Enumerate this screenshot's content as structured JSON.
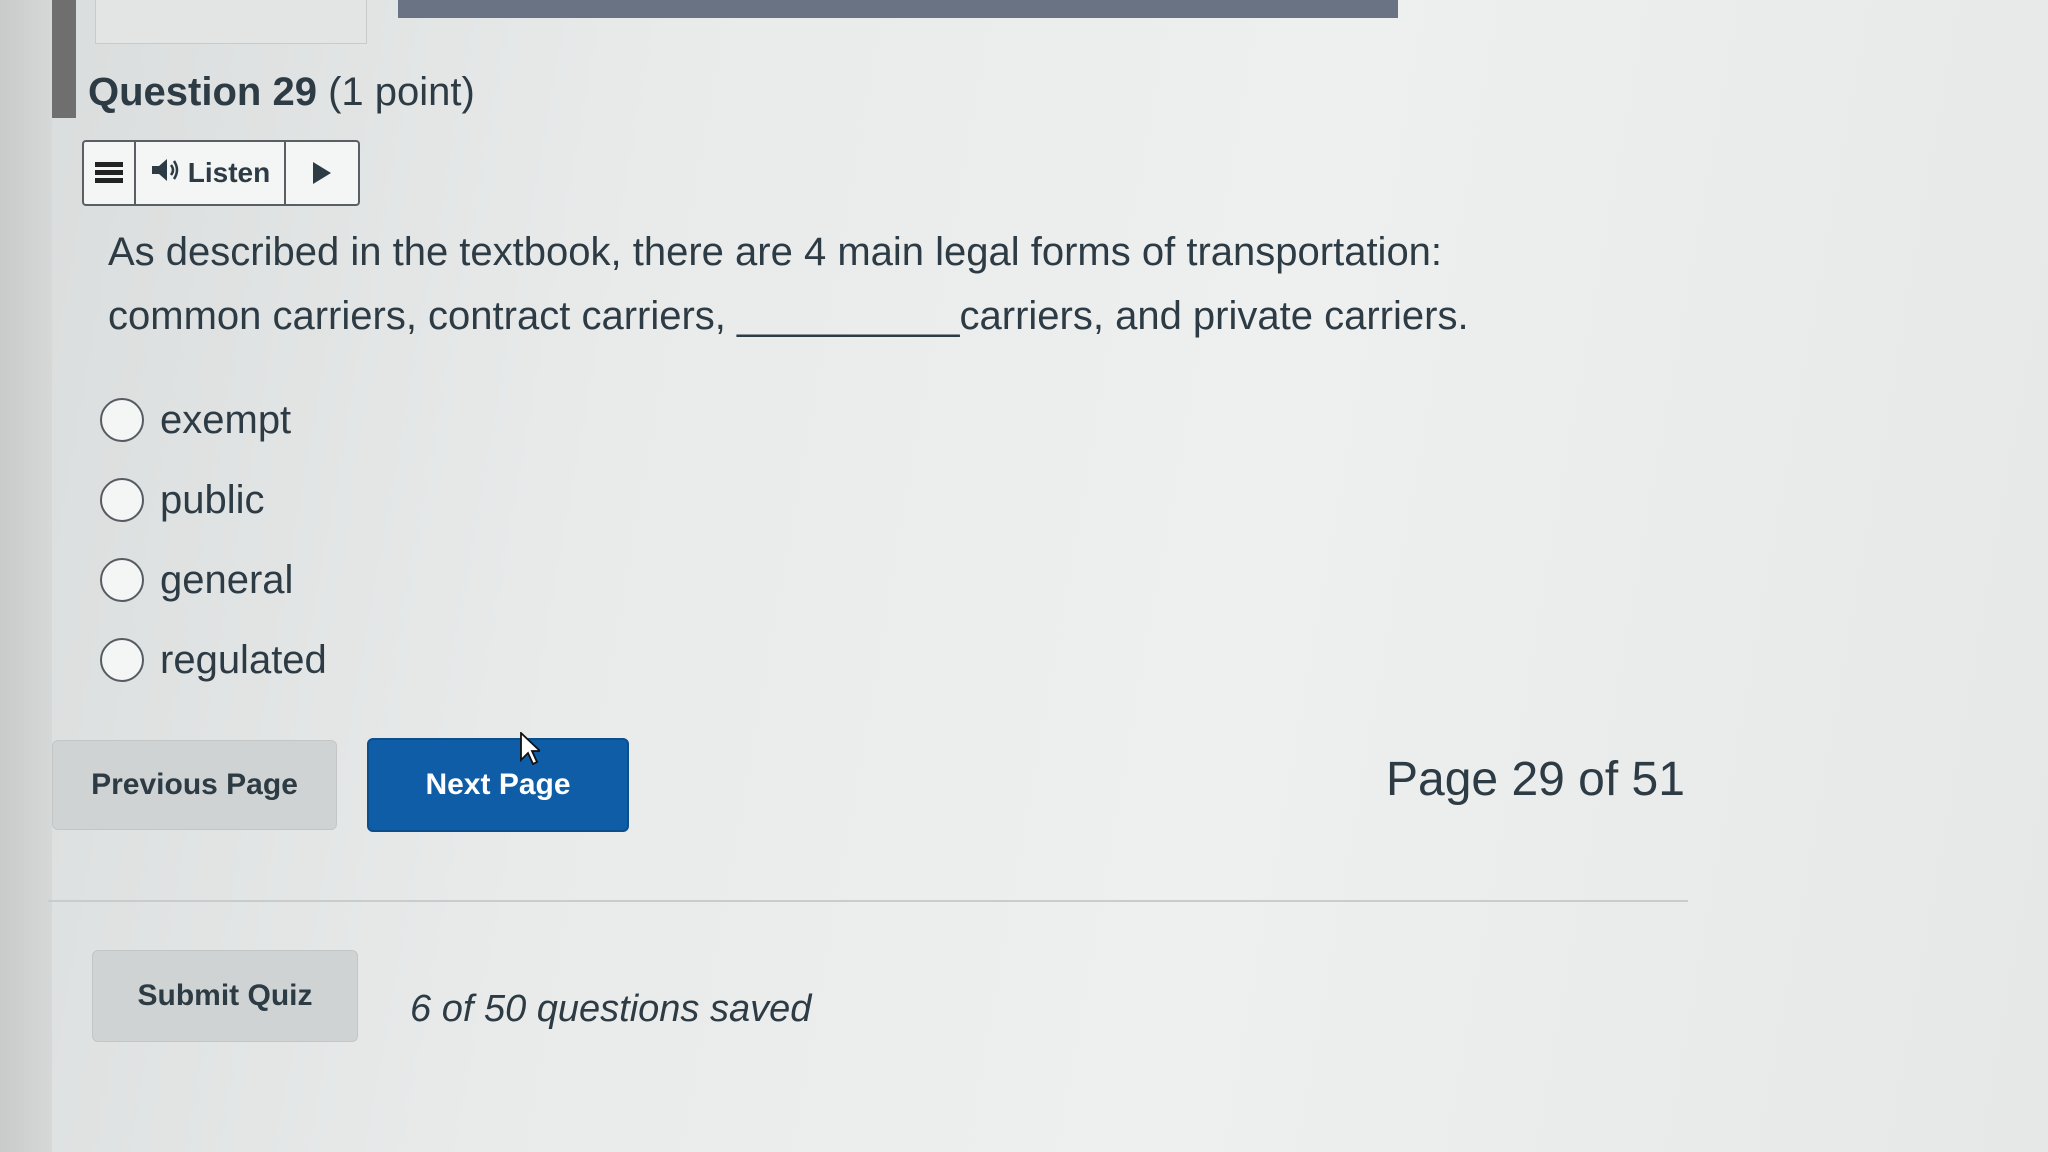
{
  "question": {
    "number_label": "Question 29",
    "points_label": "(1 point)",
    "text_line1": "As described in the textbook, there are 4 main legal forms of transportation:",
    "text_line2_part1": "common carriers, contract carriers,",
    "blank": "__________",
    "text_line2_part2": "carriers, and private carriers."
  },
  "listen": {
    "menu_icon": "menu-icon",
    "speaker_icon": "speaker-icon",
    "label": "Listen",
    "play_icon": "play-icon"
  },
  "answers": [
    {
      "label": "exempt"
    },
    {
      "label": "public"
    },
    {
      "label": "general"
    },
    {
      "label": "regulated"
    }
  ],
  "navigation": {
    "previous_label": "Previous Page",
    "next_label": "Next Page",
    "page_indicator": "Page 29 of 51"
  },
  "footer": {
    "submit_label": "Submit Quiz",
    "saved_status": "6 of 50 questions saved"
  },
  "colors": {
    "primary": "#0e5da6",
    "text": "#2d3b45",
    "secondary_button": "#d0d3d3"
  }
}
